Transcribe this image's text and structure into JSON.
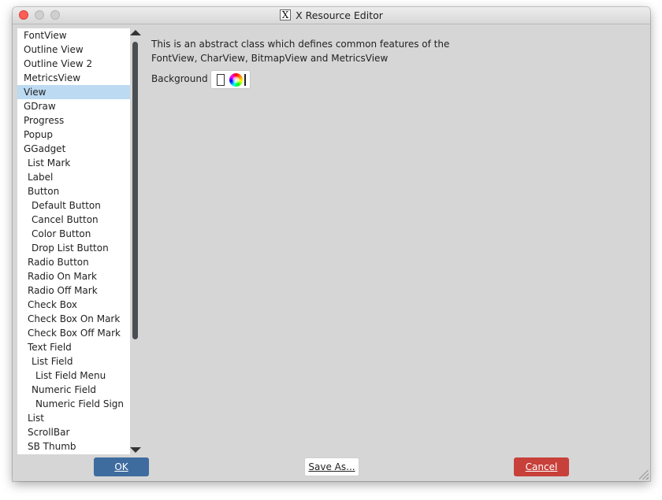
{
  "window": {
    "title": "X Resource Editor",
    "title_icon": "X"
  },
  "resource_list": [
    {
      "label": "FontView",
      "level": 0
    },
    {
      "label": "Outline View",
      "level": 0
    },
    {
      "label": "Outline View 2",
      "level": 0
    },
    {
      "label": "MetricsView",
      "level": 0
    },
    {
      "label": "View",
      "level": 0,
      "selected": true
    },
    {
      "label": "GDraw",
      "level": 0
    },
    {
      "label": "Progress",
      "level": 0
    },
    {
      "label": "Popup",
      "level": 0
    },
    {
      "label": "GGadget",
      "level": 0
    },
    {
      "label": "List Mark",
      "level": 1
    },
    {
      "label": "Label",
      "level": 1
    },
    {
      "label": "Button",
      "level": 1
    },
    {
      "label": "Default Button",
      "level": 2
    },
    {
      "label": "Cancel Button",
      "level": 2
    },
    {
      "label": "Color Button",
      "level": 2
    },
    {
      "label": "Drop List Button",
      "level": 2
    },
    {
      "label": "Radio Button",
      "level": 1
    },
    {
      "label": "Radio On Mark",
      "level": 1
    },
    {
      "label": "Radio Off Mark",
      "level": 1
    },
    {
      "label": "Check Box",
      "level": 1
    },
    {
      "label": "Check Box On Mark",
      "level": 1
    },
    {
      "label": "Check Box Off Mark",
      "level": 1
    },
    {
      "label": "Text Field",
      "level": 1
    },
    {
      "label": "List Field",
      "level": 2
    },
    {
      "label": "List Field Menu",
      "level": 3
    },
    {
      "label": "Numeric Field",
      "level": 2
    },
    {
      "label": "Numeric Field Sign",
      "level": 3
    },
    {
      "label": "List",
      "level": 1
    },
    {
      "label": "ScrollBar",
      "level": 1
    },
    {
      "label": "SB Thumb",
      "level": 1
    }
  ],
  "detail": {
    "description_line1": "This is an abstract class which defines common features of the",
    "description_line2": "FontView, CharView, BitmapView and MetricsView",
    "background_label": "Background",
    "background_color": "#ffffff"
  },
  "buttons": {
    "ok": "OK",
    "save_as": "Save As...",
    "cancel": "Cancel"
  },
  "colors": {
    "ok_button": "#3e6c9f",
    "cancel_button": "#c8403a",
    "selection": "#bcdaf1",
    "window_bg": "#d6d6d6"
  }
}
